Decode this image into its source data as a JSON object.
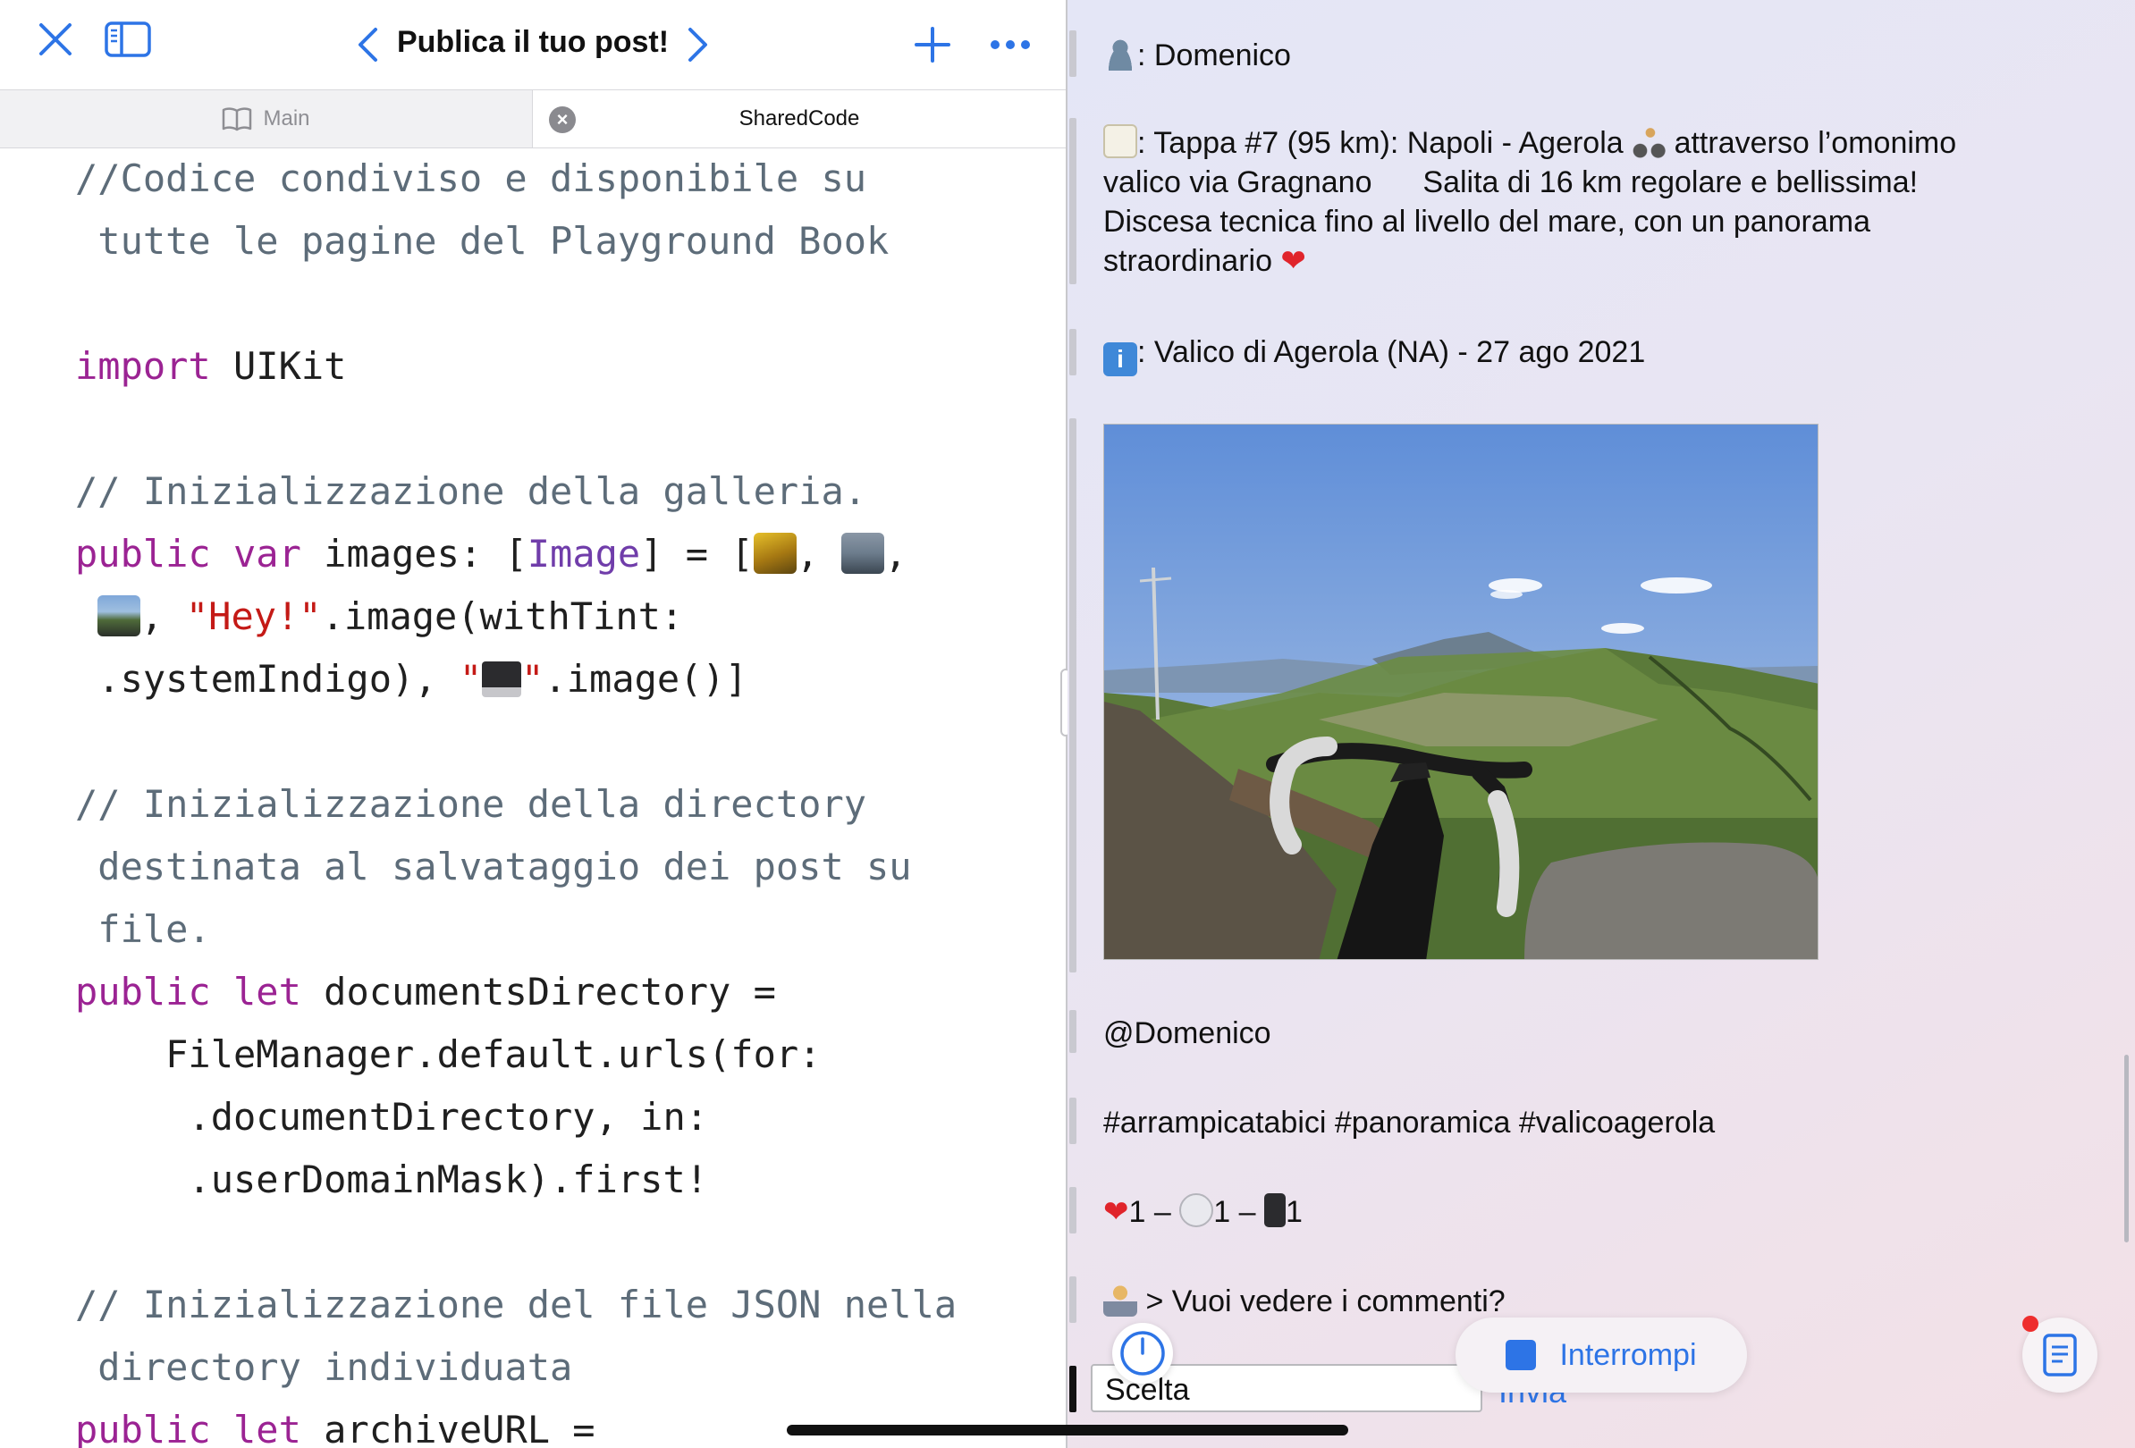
{
  "editor": {
    "title": "Publica il tuo post!",
    "tabs": [
      {
        "label": "Main"
      },
      {
        "label": "SharedCode"
      }
    ],
    "code": {
      "l1": "//Codice condiviso e disponibile su",
      "l2": " tutte le pagine del Playground Book",
      "l3_kw": "import",
      "l3_rest": " UIKit",
      "l4": "// Inizializzazione della galleria.",
      "l5_kw1": "public",
      "l5_kw2": " var",
      "l5_a": " images: [",
      "l5_type": "Image",
      "l5_b": "] = [",
      "l5_c": ", ",
      "l5_d": ",",
      "l6_a": ", ",
      "l6_str": "\"Hey!\"",
      "l6_b": ".image(withTint:",
      "l7_a": " .systemIndigo), ",
      "l7_str1": "\"",
      "l7_str2": "\"",
      "l7_b": ".image()]",
      "l8": "// Inizializzazione della directory",
      "l9": " destinata al salvataggio dei post su",
      "l10": " file.",
      "l11_kw1": "public",
      "l11_kw2": " let",
      "l11_rest": " documentsDirectory =",
      "l12": "    FileManager.default.urls(for:",
      "l13": "     .documentDirectory, in:",
      "l14": "     .userDomainMask).first!",
      "l15": "// Inizializzazione del file JSON nella",
      "l16": " directory individuata",
      "l17_kw1": "public",
      "l17_kw2": " let",
      "l17_rest": " archiveURL ="
    }
  },
  "post": {
    "author": ": Domenico",
    "text_line1_a": ": Tappa #7 (95 km): Napoli - Agerola ",
    "text_line1_b": " attraverso l’omonimo",
    "text_line2_a": "valico via Gragnano ",
    "text_line2_b": "  Salita di 16 km regolare e bellissima!",
    "text_line3": "Discesa tecnica fino al livello del mare, con un panorama",
    "text_line4": "straordinario ",
    "info": ": Valico di Agerola (NA) - 27 ago 2021",
    "mention": "@Domenico",
    "hashtags": "#arrampicatabici #panoramica #valicoagerola",
    "likes": "1 – ",
    "comments": "1 – ",
    "shares": "1",
    "prompt": " > Vuoi vedere i commenti?",
    "input_value": "Scelta",
    "send_label": "Invia"
  },
  "controls": {
    "stop_label": "Interrompi"
  },
  "colors": {
    "accent": "#2d74e6",
    "keyword": "#9b2393",
    "type": "#703daa",
    "string": "#c41a16",
    "comment": "#5d6c79"
  },
  "icons": [
    "close-icon",
    "sidebar-icon",
    "chevron-left-icon",
    "chevron-right-icon",
    "plus-icon",
    "ellipsis-icon",
    "book-icon",
    "tab-close-icon",
    "person-icon",
    "memo-icon",
    "info-icon",
    "cyclist-icon",
    "pizza-icon",
    "heart-icon",
    "speech-bubble-icon",
    "phone-icon",
    "technologist-icon",
    "timer-icon",
    "stop-icon",
    "document-icon",
    "desktop-computer-icon"
  ]
}
